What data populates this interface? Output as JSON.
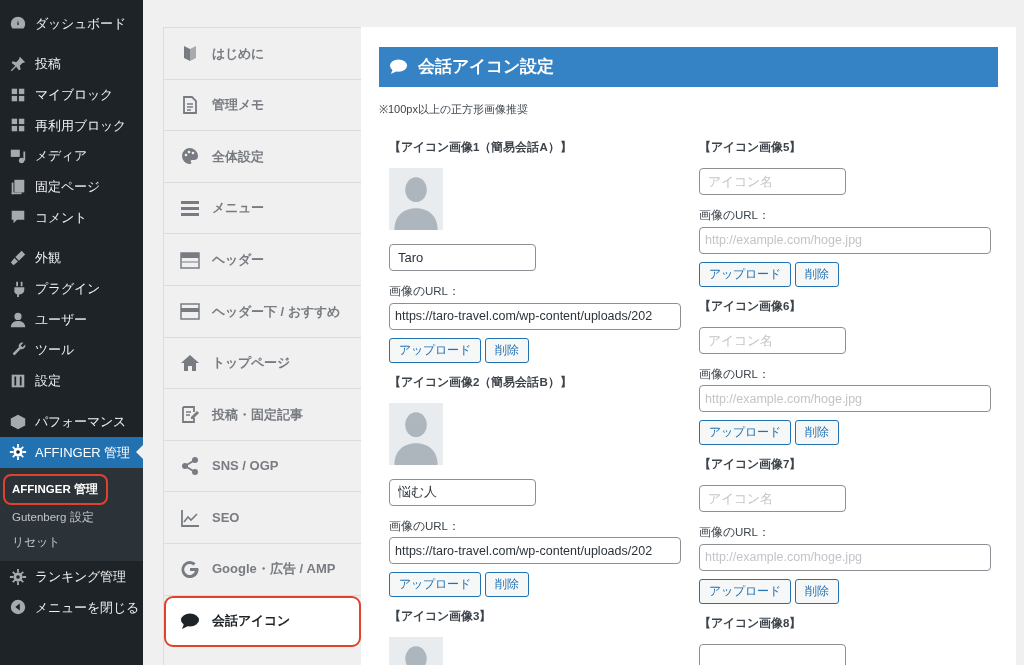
{
  "sidebar": {
    "groups": [
      {
        "items": [
          {
            "label": "ダッシュボード",
            "selected": false
          }
        ]
      },
      {
        "items": [
          {
            "label": "投稿",
            "selected": false
          },
          {
            "label": "マイブロック",
            "selected": false
          },
          {
            "label": "再利用ブロック",
            "selected": false
          },
          {
            "label": "メディア",
            "selected": false
          },
          {
            "label": "固定ページ",
            "selected": false
          },
          {
            "label": "コメント",
            "selected": false
          }
        ]
      },
      {
        "items": [
          {
            "label": "外観",
            "selected": false
          },
          {
            "label": "プラグイン",
            "selected": false
          },
          {
            "label": "ユーザー",
            "selected": false
          },
          {
            "label": "ツール",
            "selected": false
          },
          {
            "label": "設定",
            "selected": false
          }
        ]
      },
      {
        "items": [
          {
            "label": "パフォーマンス",
            "selected": false
          },
          {
            "label": "AFFINGER 管理",
            "selected": true,
            "submenu": [
              {
                "label": "AFFINGER 管理",
                "selected": true,
                "highlighted": true
              },
              {
                "label": "Gutenberg 設定",
                "selected": false,
                "highlighted": false
              },
              {
                "label": "リセット",
                "selected": false,
                "highlighted": false
              }
            ]
          },
          {
            "label": "ランキング管理",
            "selected": false
          },
          {
            "label": "メニューを閉じる",
            "selected": false
          }
        ]
      }
    ]
  },
  "tabs": [
    {
      "label": "はじめに",
      "selected": false,
      "highlighted": false
    },
    {
      "label": "管理メモ",
      "selected": false,
      "highlighted": false
    },
    {
      "label": "全体設定",
      "selected": false,
      "highlighted": false
    },
    {
      "label": "メニュー",
      "selected": false,
      "highlighted": false
    },
    {
      "label": "ヘッダー",
      "selected": false,
      "highlighted": false
    },
    {
      "label": "ヘッダー下 / おすすめ",
      "selected": false,
      "highlighted": false
    },
    {
      "label": "トップページ",
      "selected": false,
      "highlighted": false
    },
    {
      "label": "投稿・固定記事",
      "selected": false,
      "highlighted": false
    },
    {
      "label": "SNS / OGP",
      "selected": false,
      "highlighted": false
    },
    {
      "label": "SEO",
      "selected": false,
      "highlighted": false
    },
    {
      "label": "Google・広告 / AMP",
      "selected": false,
      "highlighted": false
    },
    {
      "label": "会話アイコン",
      "selected": true,
      "highlighted": true
    }
  ],
  "panel": {
    "title": "会話アイコン設定",
    "note": "※100px以上の正方形画像推奨",
    "columns": [
      [
        {
          "heading": "【アイコン画像1（簡易会話A）】",
          "avatar": true,
          "name_field": {
            "value": "Taro"
          },
          "url_label": "画像のURL：",
          "url_field": {
            "value": "https://taro-travel.com/wp-content/uploads/202"
          },
          "buttons": [
            "アップロード",
            "削除"
          ]
        },
        {
          "heading": "【アイコン画像2（簡易会話B）】",
          "avatar": true,
          "name_field": {
            "value": "悩む人"
          },
          "url_label": "画像のURL：",
          "url_field": {
            "value": "https://taro-travel.com/wp-content/uploads/202"
          },
          "buttons": [
            "アップロード",
            "削除"
          ]
        },
        {
          "heading": "【アイコン画像3】",
          "avatar": true
        }
      ],
      [
        {
          "heading": "【アイコン画像5】",
          "avatar": false,
          "name_field": {
            "placeholder": "アイコン名"
          },
          "url_label": "画像のURL：",
          "url_field": {
            "placeholder": "http://example.com/hoge.jpg"
          },
          "buttons": [
            "アップロード",
            "削除"
          ]
        },
        {
          "heading": "【アイコン画像6】",
          "avatar": false,
          "name_field": {
            "placeholder": "アイコン名"
          },
          "url_label": "画像のURL：",
          "url_field": {
            "placeholder": "http://example.com/hoge.jpg"
          },
          "buttons": [
            "アップロード",
            "削除"
          ]
        },
        {
          "heading": "【アイコン画像7】",
          "avatar": false,
          "name_field": {
            "placeholder": "アイコン名"
          },
          "url_label": "画像のURL：",
          "url_field": {
            "placeholder": "http://example.com/hoge.jpg"
          },
          "buttons": [
            "アップロード",
            "削除"
          ]
        },
        {
          "heading": "【アイコン画像8】",
          "avatar": false,
          "empty_name_field": true
        }
      ]
    ]
  }
}
